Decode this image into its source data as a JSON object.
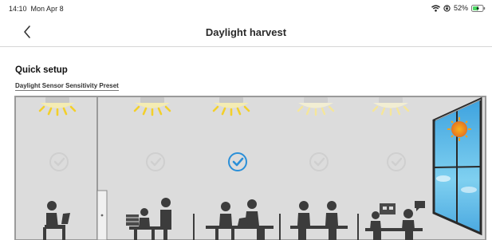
{
  "status_bar": {
    "time": "14:10",
    "date": "Mon Apr 8",
    "battery_percent": "52%"
  },
  "header": {
    "title": "Daylight harvest",
    "back_icon": "chevron-left-icon"
  },
  "main": {
    "section_title": "Quick setup",
    "preset_label": "Daylight Sensor Sensitivity Preset",
    "presets": [
      {
        "id": "preset-1",
        "selected": false
      },
      {
        "id": "preset-2",
        "selected": false
      },
      {
        "id": "preset-3",
        "selected": true
      },
      {
        "id": "preset-4",
        "selected": false
      },
      {
        "id": "preset-5",
        "selected": false
      }
    ]
  },
  "colors": {
    "accent": "#2a8fd8",
    "room_wall": "#dcdcdc",
    "room_border": "#9a9a9a",
    "lamp_glow": "#f3d02a",
    "check_inactive": "#cfcfcf",
    "figure": "#3c3c3c",
    "window_sky": "#5cb8e8"
  }
}
